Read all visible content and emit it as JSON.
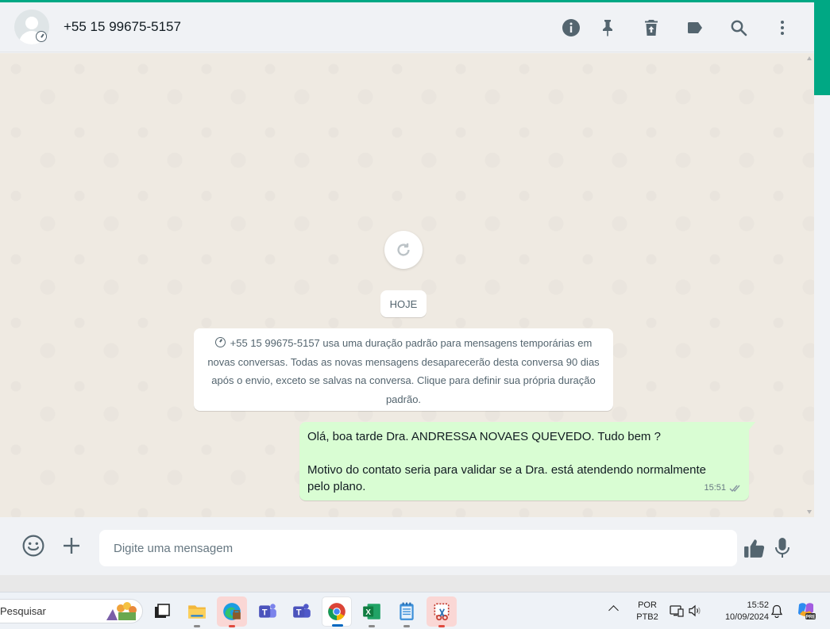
{
  "colors": {
    "accent": "#00a884",
    "bubble_out": "#d9fdd3",
    "chat_bg": "#efeae2",
    "header_bg": "#f0f2f5",
    "read_ticks": "#8696a0"
  },
  "header": {
    "contact_name": "+55 15 99675-5157",
    "icons": [
      "info-icon",
      "pin-icon",
      "delete-icon",
      "label-icon",
      "search-icon",
      "menu-icon"
    ]
  },
  "chat": {
    "date_chip": "HOJE",
    "system_message": "+55 15 99675-5157 usa uma duração padrão para mensagens temporárias em novas conversas. Todas as novas mensagens desaparecerão desta conversa 90 dias após o envio, exceto se salvas na conversa. Clique para definir sua própria duração padrão.",
    "messages": [
      {
        "direction": "out",
        "line1": "Olá, boa tarde Dra. ANDRESSA NOVAES QUEVEDO. Tudo bem ?",
        "line2": "Motivo do contato seria para validar se a Dra. está atendendo normalmente pelo plano.",
        "time": "15:51",
        "status": "read"
      }
    ]
  },
  "composer": {
    "placeholder": "Digite uma mensagem",
    "value": "",
    "icons": [
      "emoji-icon",
      "plus-icon",
      "thumbs-up-icon",
      "mic-icon"
    ]
  },
  "taskbar": {
    "search_label": "Pesquisar",
    "apps": [
      "task-view",
      "file-explorer",
      "edge",
      "teams",
      "teams-classic",
      "chrome",
      "excel",
      "notepad",
      "snipping-tool"
    ],
    "language": {
      "line1": "POR",
      "line2": "PTB2"
    },
    "clock": {
      "time": "15:52",
      "date": "10/09/2024"
    }
  }
}
